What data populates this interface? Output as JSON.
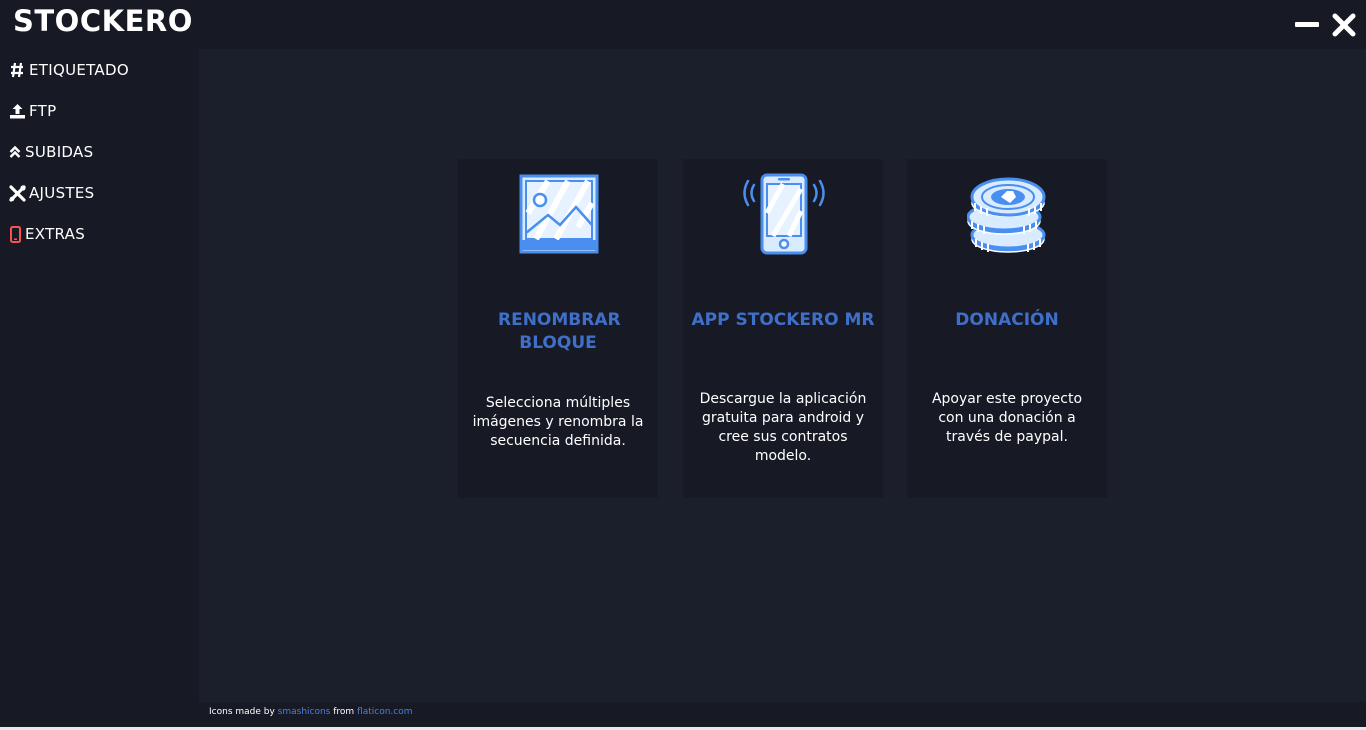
{
  "app": {
    "title": "STOCKERO"
  },
  "window": {
    "minimize_icon": "minimize-icon",
    "close_icon": "close-icon"
  },
  "sidebar": {
    "items": [
      {
        "label": "ETIQUETADO",
        "icon": "hash-icon"
      },
      {
        "label": "FTP",
        "icon": "upload-icon"
      },
      {
        "label": "SUBIDAS",
        "icon": "double-chevron-up-icon"
      },
      {
        "label": "AJUSTES",
        "icon": "tools-icon"
      },
      {
        "label": "EXTRAS",
        "icon": "mobile-icon",
        "icon_color": "#ff4f4f"
      }
    ]
  },
  "cards": [
    {
      "title": "RENOMBRAR BLOQUE",
      "description": "Selecciona múltiples imágenes y renombra la secuencia definida.",
      "icon": "image-icon"
    },
    {
      "title": "APP STOCKERO MR",
      "description": "Descargue la aplicación gratuita para android y cree sus contratos modelo.",
      "icon": "smartphone-icon"
    },
    {
      "title": "DONACIÓN",
      "description": "Apoyar este proyecto con una donación a través de paypal.",
      "icon": "coins-icon"
    }
  ],
  "footer": {
    "prefix": "Icons made by ",
    "author": "smashicons",
    "middle": " from ",
    "site": "flaticon.com"
  },
  "colors": {
    "accent": "#3f6fc8",
    "icon_blue": "#4a8ff0",
    "background": "#1b1e2b",
    "panel": "#171a25",
    "extras": "#ff4f4f"
  }
}
